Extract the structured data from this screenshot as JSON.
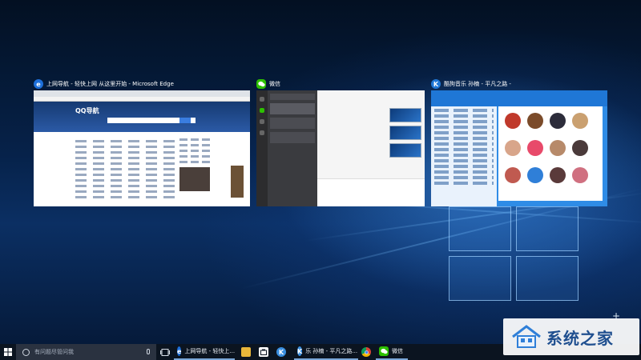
{
  "colors": {
    "edge_blue": "#1e6fd9",
    "wechat_green": "#2dc100",
    "kugou_blue": "#2f8ce6",
    "taskbar_bg": "#0b1420",
    "active_underline": "#7aa7d8"
  },
  "task_view": {
    "windows": [
      {
        "icon": "edge-icon",
        "icon_glyph": "e",
        "title": "上网导航 - 轻快上网 从这里开始 - Microsoft Edge"
      },
      {
        "icon": "wechat-icon",
        "icon_glyph": "",
        "title": "微信"
      },
      {
        "icon": "kugou-icon",
        "icon_glyph": "K",
        "title": "酷狗音乐 孙楠 - 平凡之路 -"
      }
    ],
    "edge_thumb": {
      "site_logo": "QQ导航"
    }
  },
  "taskbar": {
    "search_placeholder": "有问题尽管问我",
    "items": [
      {
        "icon": "edge-icon",
        "icon_glyph": "e",
        "label": "上网导航 - 轻快上..."
      },
      {
        "icon": "file-explorer-icon",
        "label": ""
      },
      {
        "icon": "store-icon",
        "label": ""
      },
      {
        "icon": "kugou-icon",
        "icon_glyph": "K",
        "label": ""
      },
      {
        "icon": "kugou-icon",
        "icon_glyph": "K",
        "label": "乐 孙楠 - 平凡之路..."
      },
      {
        "icon": "chrome-icon",
        "label": ""
      },
      {
        "icon": "wechat-icon",
        "label": "微信"
      }
    ]
  },
  "watermark": {
    "text": "系统之家"
  }
}
